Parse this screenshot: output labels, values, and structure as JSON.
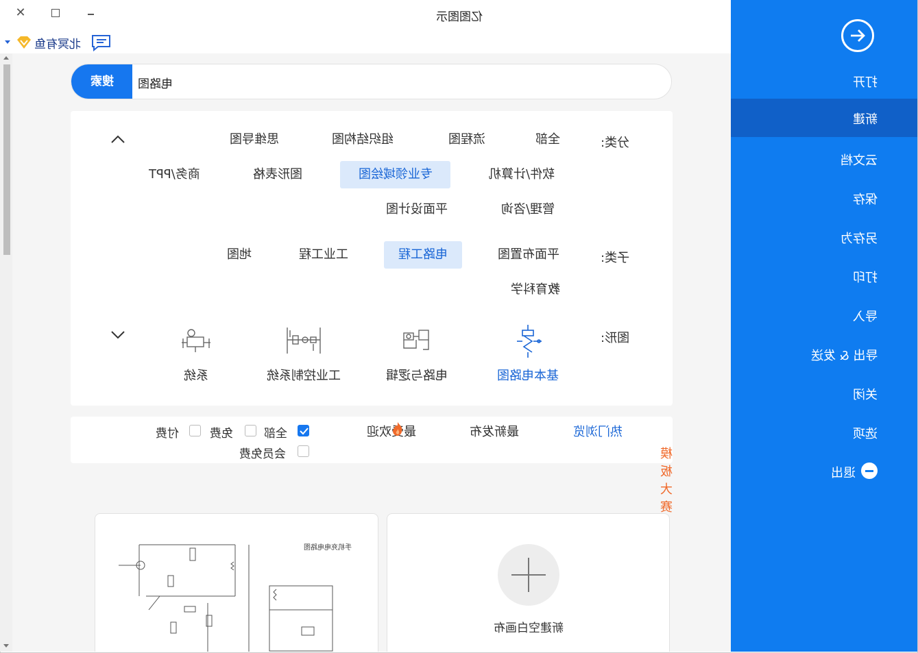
{
  "window": {
    "title": "亿图图示",
    "user_name": "北冥有鱼"
  },
  "search": {
    "button_label": "搜索",
    "value": "电路图"
  },
  "filters": {
    "category_label": "分类:",
    "categories": [
      "全部",
      "流程图",
      "组织结构图",
      "思维导图",
      "软件/计算机",
      "专业领域绘图",
      "图形表格",
      "商务/PPT",
      "管理/咨询",
      "平面设计图"
    ],
    "category_selected": "专业领域绘图",
    "subcategory_label": "子类:",
    "subcategories": [
      "平面布置图",
      "电路工程",
      "工业工程",
      "地图",
      "教育科学"
    ],
    "subcategory_selected": "电路工程",
    "shapes_label": "图形:",
    "shapes": [
      "基本电路图",
      "电路与逻辑",
      "工业控制系统",
      "系统"
    ],
    "shape_selected": "基本电路图"
  },
  "sort": {
    "hot": "热门浏览",
    "newest": "最新发布",
    "popular": "最受欢迎",
    "contest": "模板大赛",
    "checkbox_all": "全部",
    "checkbox_free": "免费",
    "checkbox_paid": "付费",
    "checkbox_member": "会员免费"
  },
  "cards": {
    "new_blank": "新建空白画布",
    "circuit_title": "手机充电电路图"
  },
  "sidebar": {
    "items": [
      "打开",
      "新建",
      "云文档",
      "保存",
      "另存为",
      "打印",
      "导入",
      "导出 & 发送",
      "关闭",
      "选项",
      "退出"
    ],
    "active": "新建"
  },
  "colors": {
    "accent": "#1677ef",
    "sidebar": "#0f7cf0",
    "sidebar_active": "#1060c8",
    "contest": "#f06a2b"
  }
}
